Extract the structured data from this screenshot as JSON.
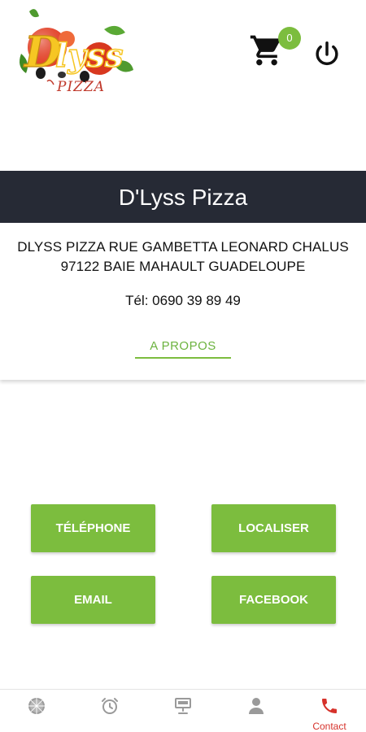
{
  "header": {
    "logo_alt": "D'Lyss Pizza",
    "cart_count": "0"
  },
  "store": {
    "name": "D'Lyss Pizza",
    "address_line1": "DLYSS PIZZA RUE GAMBETTA LEONARD CHALUS",
    "address_line2": "97122 BAIE MAHAULT GUADELOUPE",
    "phone": "Tél: 0690 39 89 49",
    "about_label": "A PROPOS"
  },
  "actions": {
    "phone": "TÉLÉPHONE",
    "locate": "LOCALISER",
    "email": "EMAIL",
    "facebook": "FACEBOOK"
  },
  "nav": {
    "items": [
      {
        "icon": "pizza-icon"
      },
      {
        "icon": "alarm-clock-icon"
      },
      {
        "icon": "cash-register-icon"
      },
      {
        "icon": "user-icon"
      },
      {
        "icon": "phone-icon",
        "label": "Contact"
      }
    ]
  },
  "colors": {
    "accent_green": "#7cbd3e",
    "banner_dark": "#262a35",
    "active_red": "#d6322b",
    "inactive_gray": "#9a9a9a"
  }
}
